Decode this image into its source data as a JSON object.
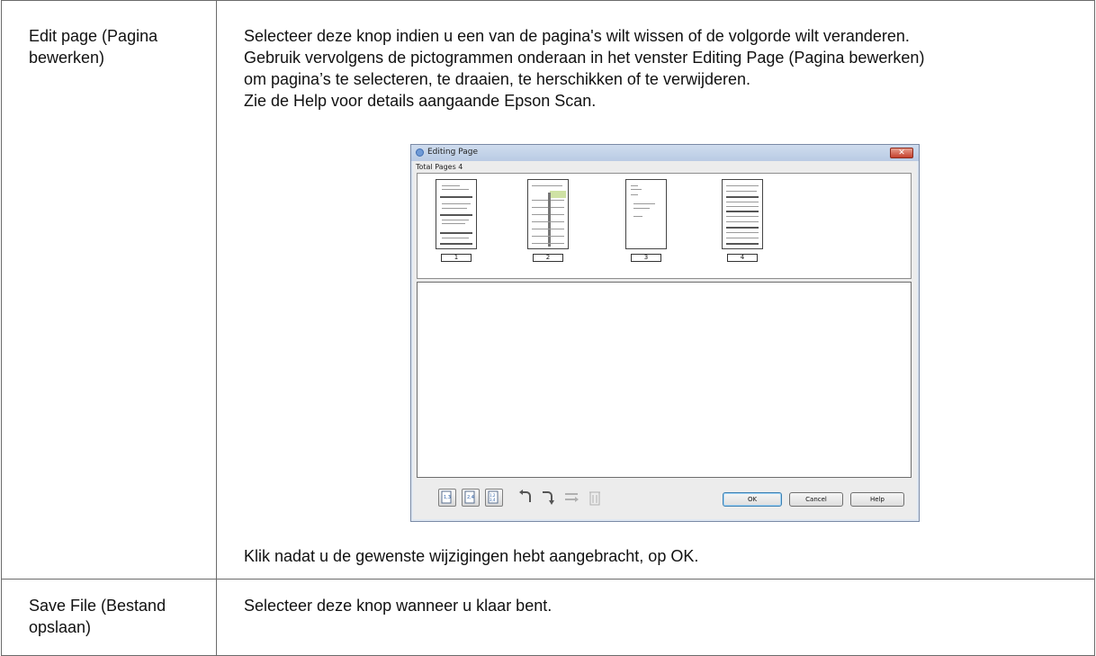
{
  "rows": [
    {
      "term": [
        "Edit page (Pagina",
        "bewerken)"
      ],
      "description_lines": [
        "Selecteer deze knop indien u een van de pagina's wilt wissen of de volgorde wilt veranderen.",
        "Gebruik vervolgens de pictogrammen onderaan in het venster Editing Page (Pagina bewerken)",
        "om pagina’s te selecteren, te draaien, te herschikken of te verwijderen.",
        "Zie de Help voor details aangaande Epson Scan."
      ],
      "after_figure": "Klik nadat u de gewenste wijzigingen hebt aangebracht, op OK."
    },
    {
      "term": [
        "Save File (Bestand",
        "opslaan)"
      ],
      "description_lines": [
        "Selecteer deze knop wanneer u klaar bent."
      ]
    }
  ],
  "dialog": {
    "title": "Editing Page",
    "close_glyph": "✕",
    "total_pages": "Total Pages 4",
    "pages": [
      "1",
      "2",
      "3",
      "4"
    ],
    "toolbar_icons": [
      "select-odd-pages-icon",
      "select-even-pages-icon",
      "select-all-pages-icon",
      "rotate-left-icon",
      "rotate-right-icon",
      "reorder-pages-icon",
      "delete-page-icon"
    ],
    "buttons": {
      "ok": "OK",
      "cancel": "Cancel",
      "help": "Help"
    }
  }
}
